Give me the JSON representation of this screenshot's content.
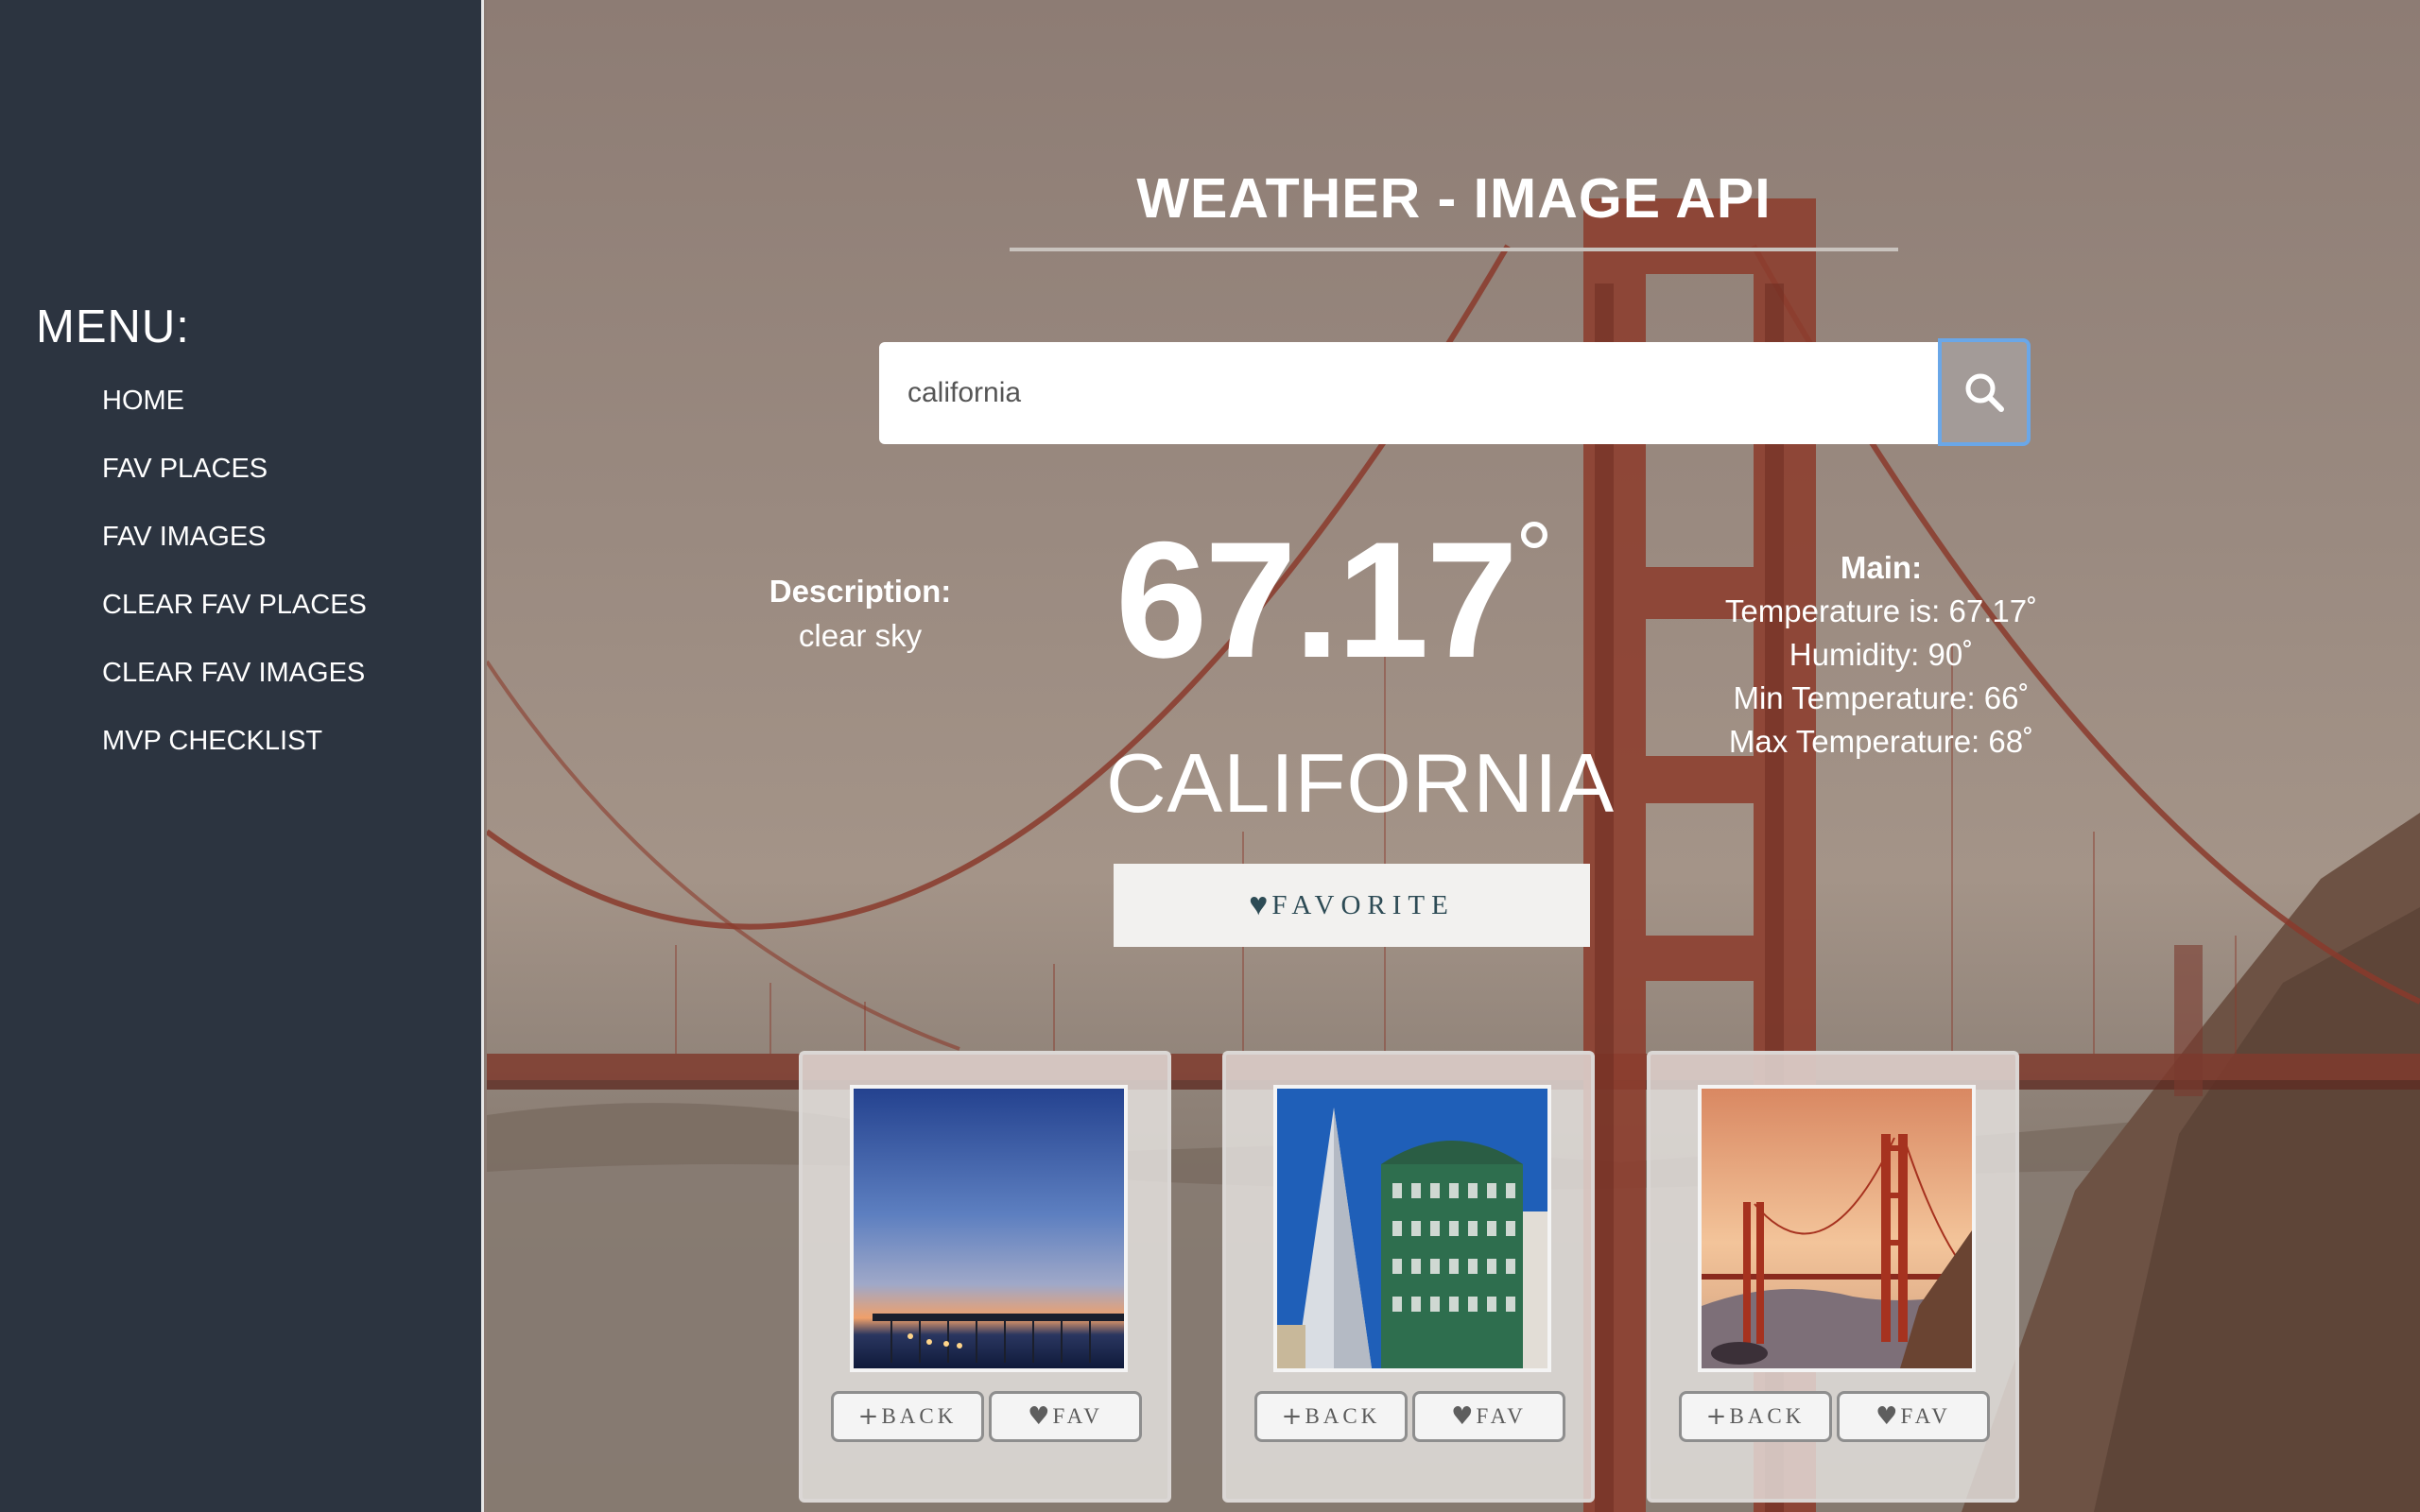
{
  "sidebar": {
    "title": "MENU:",
    "items": [
      {
        "label": "HOME"
      },
      {
        "label": "FAV PLACES"
      },
      {
        "label": "FAV IMAGES"
      },
      {
        "label": "CLEAR FAV PLACES"
      },
      {
        "label": "CLEAR FAV IMAGES"
      },
      {
        "label": "MVP CHECKLIST"
      }
    ]
  },
  "header": {
    "title": "WEATHER - IMAGE API"
  },
  "search": {
    "value": "california",
    "icon": "search-icon"
  },
  "weather": {
    "description_label": "Description:",
    "description_value": "clear sky",
    "temperature": "67.17",
    "degree_symbol": "°",
    "city": "CALIFORNIA",
    "main_label": "Main:",
    "temperature_line": "Temperature is: 67.17˚",
    "humidity_line": "Humidity: 90˚",
    "min_temp_line": "Min Temperature: 66˚",
    "max_temp_line": "Max Temperature: 68˚"
  },
  "favorite_button": {
    "label": "FAVORITE",
    "icon": "heart-icon"
  },
  "cards": [
    {
      "subject": "pier at sunset",
      "back_label": "BACK",
      "fav_label": "FAV"
    },
    {
      "subject": "transamerica pyramid and columbus tower",
      "back_label": "BACK",
      "fav_label": "FAV"
    },
    {
      "subject": "golden gate bridge",
      "back_label": "BACK",
      "fav_label": "FAV"
    }
  ],
  "colors": {
    "sidebar_bg": "#2c3440",
    "favorite_text": "#2d4b55",
    "search_focus": "#6aa7e8"
  }
}
